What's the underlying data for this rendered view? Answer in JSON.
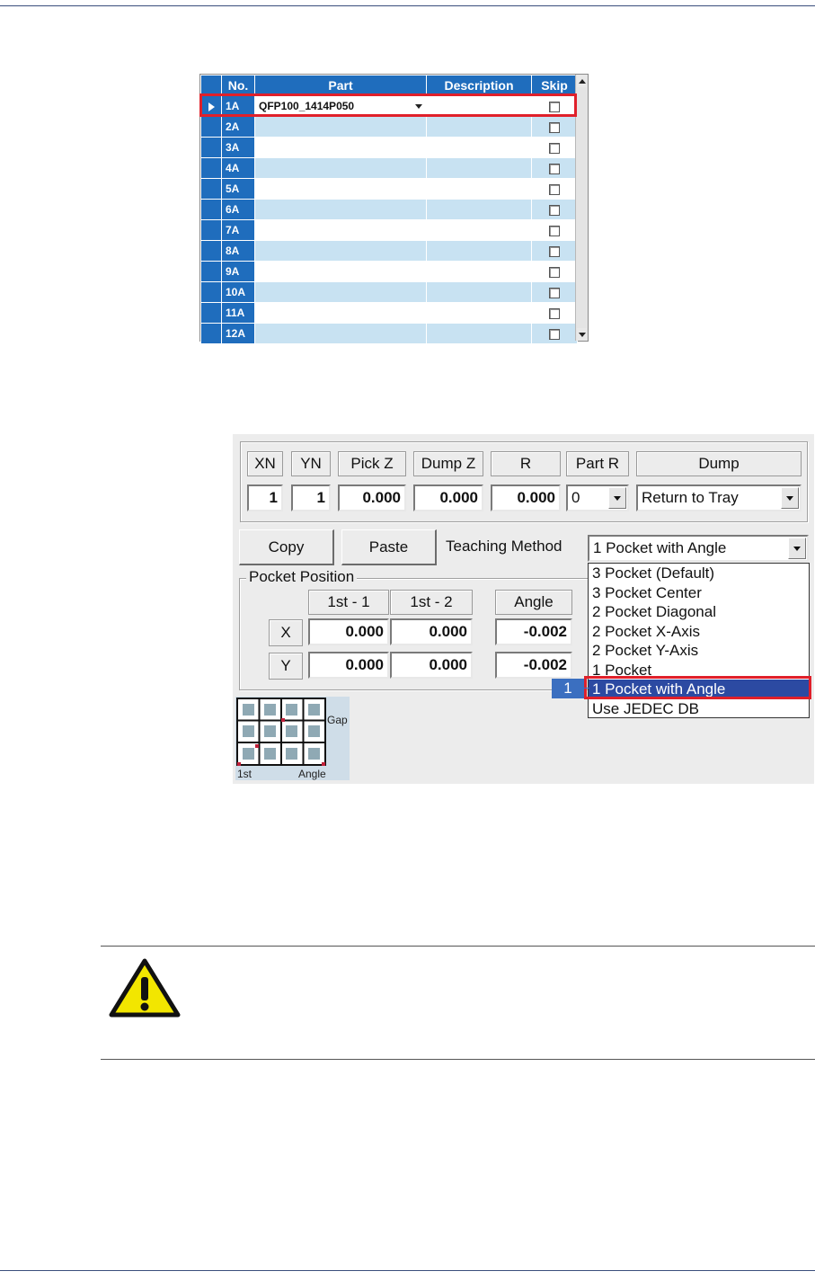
{
  "grid": {
    "columns": [
      "No.",
      "Part",
      "Description",
      "Skip"
    ],
    "rows": [
      {
        "no": "1A",
        "part": "QFP100_1414P050"
      },
      {
        "no": "2A",
        "part": ""
      },
      {
        "no": "3A",
        "part": ""
      },
      {
        "no": "4A",
        "part": ""
      },
      {
        "no": "5A",
        "part": ""
      },
      {
        "no": "6A",
        "part": ""
      },
      {
        "no": "7A",
        "part": ""
      },
      {
        "no": "8A",
        "part": ""
      },
      {
        "no": "9A",
        "part": ""
      },
      {
        "no": "10A",
        "part": ""
      },
      {
        "no": "11A",
        "part": ""
      },
      {
        "no": "12A",
        "part": ""
      }
    ]
  },
  "tray": {
    "headers": {
      "xn": "XN",
      "yn": "YN",
      "pick_z": "Pick Z",
      "dump_z": "Dump Z",
      "r": "R",
      "part_r": "Part R",
      "dump": "Dump"
    },
    "values": {
      "xn": "1",
      "yn": "1",
      "pick_z": "0.000",
      "dump_z": "0.000",
      "r": "0.000",
      "part_r": "0",
      "dump": "Return to Tray"
    },
    "copy_label": "Copy",
    "paste_label": "Paste",
    "teaching_method_label": "Teaching Method",
    "teaching_method_value": "1 Pocket with Angle",
    "teaching_options": [
      "3 Pocket (Default)",
      "3 Pocket Center",
      "2 Pocket Diagonal",
      "2 Pocket X-Axis",
      "2 Pocket Y-Axis",
      "1 Pocket",
      "1 Pocket with Angle",
      "Use JEDEC DB"
    ],
    "callout": "1"
  },
  "pocket": {
    "title": "Pocket Position",
    "col1": "1st - 1",
    "col2": "1st  - 2",
    "angle_label": "Angle",
    "x_label": "X",
    "y_label": "Y",
    "x1": "0.000",
    "x2": "0.000",
    "x_angle": "-0.002",
    "y1": "0.000",
    "y2": "0.000",
    "y_angle": "-0.002"
  },
  "tray_diagram": {
    "gap": "Gap",
    "first": "1st",
    "angle": "Angle"
  },
  "colors": {
    "grid_header": "#1f6dbd",
    "row_alt": "#c8e2f2",
    "highlight_red": "#e0202a",
    "selection_blue": "#2c4aa2",
    "caution_yellow": "#f2e600"
  }
}
